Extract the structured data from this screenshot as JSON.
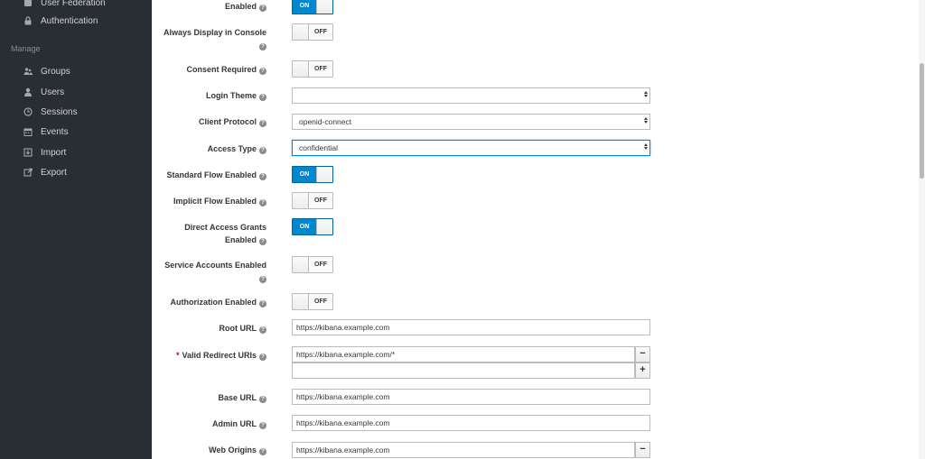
{
  "sidebar": {
    "items_top": [
      {
        "label": "User Federation",
        "icon": "user-federation-icon"
      },
      {
        "label": "Authentication",
        "icon": "lock-icon"
      }
    ],
    "section_label": "Manage",
    "items_manage": [
      {
        "label": "Groups",
        "icon": "groups-icon"
      },
      {
        "label": "Users",
        "icon": "user-icon"
      },
      {
        "label": "Sessions",
        "icon": "clock-icon"
      },
      {
        "label": "Events",
        "icon": "calendar-icon"
      },
      {
        "label": "Import",
        "icon": "import-icon"
      },
      {
        "label": "Export",
        "icon": "export-icon"
      }
    ]
  },
  "form": {
    "enabled": {
      "label": "Enabled",
      "state": "ON"
    },
    "always_display": {
      "label": "Always Display in Console",
      "state": "OFF"
    },
    "consent_required": {
      "label": "Consent Required",
      "state": "OFF"
    },
    "login_theme": {
      "label": "Login Theme",
      "value": ""
    },
    "client_protocol": {
      "label": "Client Protocol",
      "value": "openid-connect"
    },
    "access_type": {
      "label": "Access Type",
      "value": "confidential"
    },
    "standard_flow": {
      "label": "Standard Flow Enabled",
      "state": "ON"
    },
    "implicit_flow": {
      "label": "Implicit Flow Enabled",
      "state": "OFF"
    },
    "direct_access_line1": "Direct Access Grants",
    "direct_access_line2": "Enabled",
    "direct_access_state": "ON",
    "service_accounts": {
      "label": "Service Accounts Enabled",
      "state": "OFF"
    },
    "authorization": {
      "label": "Authorization Enabled",
      "state": "OFF"
    },
    "root_url": {
      "label": "Root URL",
      "value": "https://kibana.example.com"
    },
    "valid_redirect": {
      "label": "Valid Redirect URIs",
      "value": "https://kibana.example.com/*",
      "value2": ""
    },
    "base_url": {
      "label": "Base URL",
      "value": "https://kibana.example.com"
    },
    "admin_url": {
      "label": "Admin URL",
      "value": "https://kibana.example.com"
    },
    "web_origins": {
      "label": "Web Origins",
      "value": "https://kibana.example.com"
    }
  },
  "symbols": {
    "help": "?",
    "required": "*",
    "remove": "−",
    "add": "+"
  },
  "colors": {
    "sidebar": "#292e34",
    "accent": "#0088ce"
  }
}
